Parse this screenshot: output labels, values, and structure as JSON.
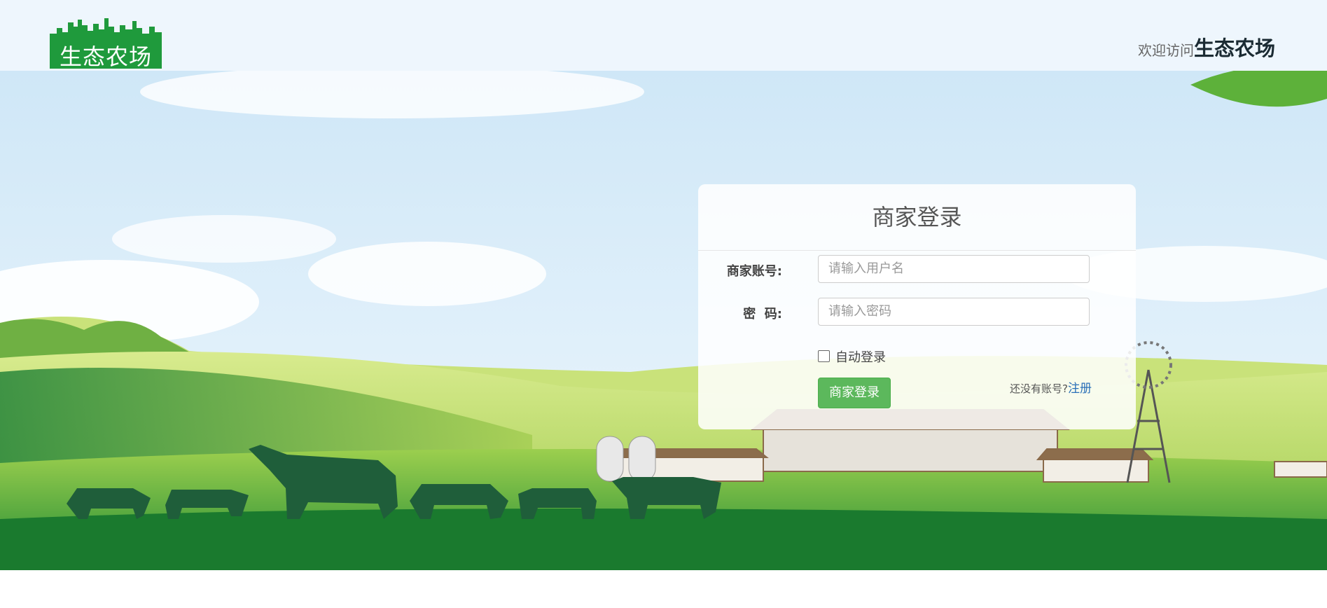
{
  "header": {
    "logo_text": "生态农场",
    "welcome_prefix": "欢迎访问",
    "welcome_brand": "生态农场"
  },
  "login": {
    "title": "商家登录",
    "account_label": "商家账号:",
    "account_placeholder": "请输入用户名",
    "password_label": "密  码:",
    "password_placeholder": "请输入密码",
    "auto_login_label": "自动登录",
    "auto_login_checked": false,
    "submit_label": "商家登录",
    "register_prompt": "还没有账号?",
    "register_link": "注册"
  },
  "colors": {
    "brand_green": "#1f9a3c",
    "button_green": "#5cb85c",
    "link_blue": "#2a6fb8"
  }
}
